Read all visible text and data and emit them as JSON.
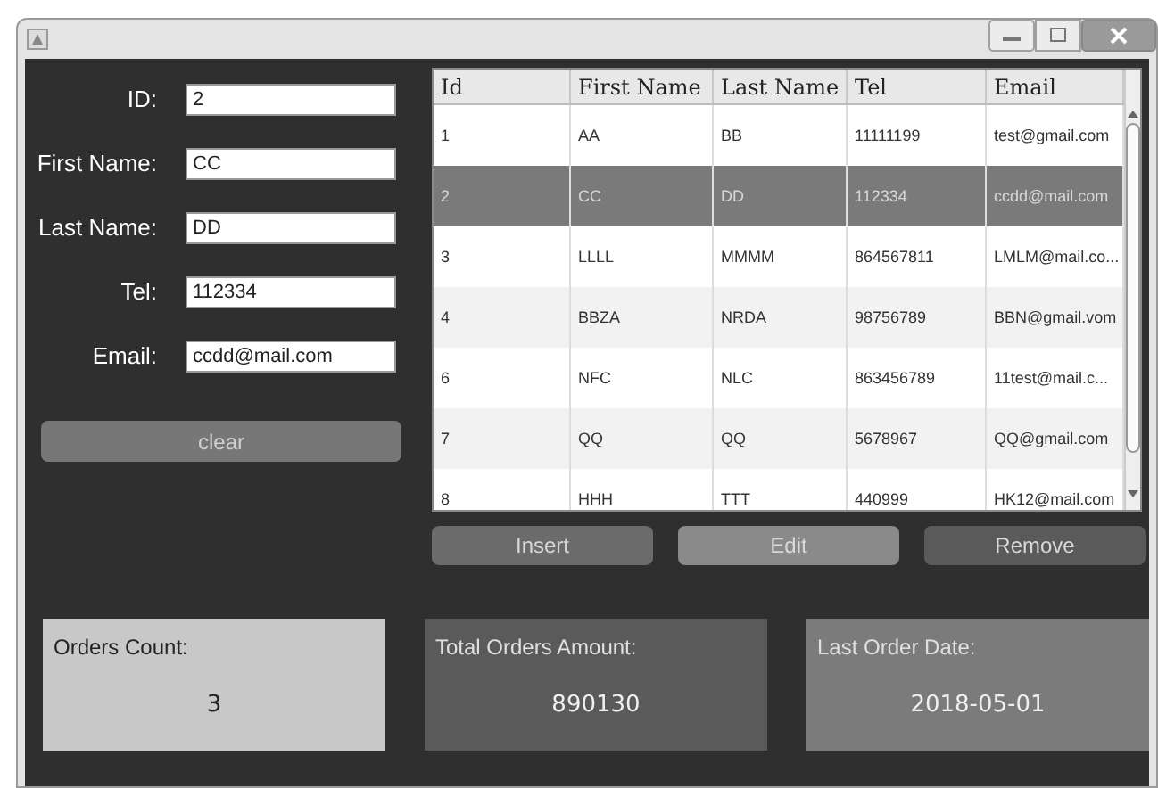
{
  "form": {
    "fields": [
      {
        "label": "ID:",
        "value": "2"
      },
      {
        "label": "First Name:",
        "value": "CC"
      },
      {
        "label": "Last Name:",
        "value": "DD"
      },
      {
        "label": "Tel:",
        "value": "112334"
      },
      {
        "label": "Email:",
        "value": "ccdd@mail.com"
      }
    ],
    "clear_button": "clear"
  },
  "table": {
    "columns": [
      "Id",
      "First Name",
      "Last Name",
      "Tel",
      "Email"
    ],
    "rows": [
      {
        "cells": [
          "1",
          "AA",
          "BB",
          "11111199",
          "test@gmail.com"
        ],
        "selected": false
      },
      {
        "cells": [
          "2",
          "CC",
          "DD",
          "112334",
          "ccdd@mail.com"
        ],
        "selected": true
      },
      {
        "cells": [
          "3",
          "LLLL",
          "MMMM",
          "864567811",
          "LMLM@mail.co..."
        ],
        "selected": false
      },
      {
        "cells": [
          "4",
          "BBZA",
          "NRDA",
          "98756789",
          "BBN@gmail.vom"
        ],
        "selected": false
      },
      {
        "cells": [
          "6",
          "NFC",
          "NLC",
          "863456789",
          "11test@mail.c..."
        ],
        "selected": false
      },
      {
        "cells": [
          "7",
          "QQ",
          "QQ",
          "5678967",
          "QQ@gmail.com"
        ],
        "selected": false
      },
      {
        "cells": [
          "8",
          "HHH",
          "TTT",
          "440999",
          "HK12@mail.com"
        ],
        "selected": false
      }
    ]
  },
  "buttons": [
    "Insert",
    "Edit",
    "Remove"
  ],
  "cards": [
    {
      "title": "Orders Count:",
      "value": "3",
      "color": "#c8c8c8"
    },
    {
      "title": "Total Orders Amount:",
      "value": "890130",
      "color": "#5a5a5a"
    },
    {
      "title": "Last Order Date:",
      "value": "2018-05-01",
      "color": "#7b7b7b"
    }
  ]
}
